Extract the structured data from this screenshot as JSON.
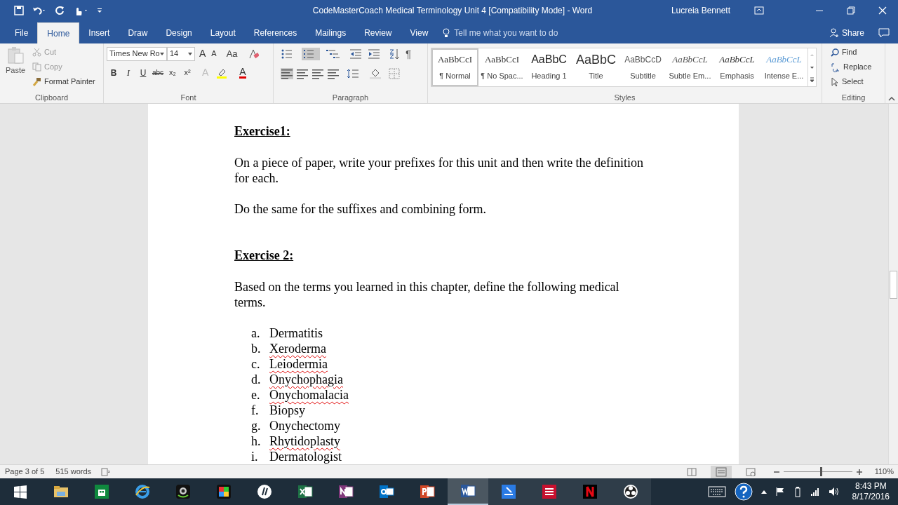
{
  "window": {
    "title": "CodeMasterCoach Medical Terminology Unit 4 [Compatibility Mode] - Word",
    "user": "Lucreia Bennett"
  },
  "tabs": [
    {
      "label": "File",
      "selected": false
    },
    {
      "label": "Home",
      "selected": true
    },
    {
      "label": "Insert",
      "selected": false
    },
    {
      "label": "Draw",
      "selected": false
    },
    {
      "label": "Design",
      "selected": false
    },
    {
      "label": "Layout",
      "selected": false
    },
    {
      "label": "References",
      "selected": false
    },
    {
      "label": "Mailings",
      "selected": false
    },
    {
      "label": "Review",
      "selected": false
    },
    {
      "label": "View",
      "selected": false
    }
  ],
  "tell_me": {
    "placeholder": "Tell me what you want to do"
  },
  "share": "Share",
  "clipboard": {
    "paste": "Paste",
    "cut": "Cut",
    "copy": "Copy",
    "format_painter": "Format Painter",
    "label": "Clipboard"
  },
  "font": {
    "name": "Times New Ro",
    "size": "14",
    "grow": "A",
    "shrink": "A",
    "case": "Aa",
    "buttons": [
      "B",
      "I",
      "U",
      "abc",
      "x₂",
      "x²"
    ],
    "text_effects": "A",
    "font_color": "A",
    "label": "Font"
  },
  "paragraph": {
    "label": "Paragraph",
    "pilcrow": "¶"
  },
  "styles": {
    "label": "Styles",
    "items": [
      {
        "preview": "AaBbCcI",
        "name": "¶ Normal",
        "kind": "body",
        "selected": true
      },
      {
        "preview": "AaBbCcI",
        "name": "¶ No Spac...",
        "kind": "body",
        "selected": false
      },
      {
        "preview": "AaBbC",
        "name": "Heading 1",
        "kind": "heading",
        "selected": false
      },
      {
        "preview": "AaBbC",
        "name": "Title",
        "kind": "title",
        "selected": false
      },
      {
        "preview": "AaBbCcD",
        "name": "Subtitle",
        "kind": "subtitle",
        "selected": false
      },
      {
        "preview": "AaBbCcL",
        "name": "Subtle Em...",
        "kind": "subtle",
        "selected": false
      },
      {
        "preview": "AaBbCcL",
        "name": "Emphasis",
        "kind": "emphasis",
        "selected": false
      },
      {
        "preview": "AaBbCcL",
        "name": "Intense E...",
        "kind": "intense",
        "selected": false
      }
    ]
  },
  "editing": {
    "find": "Find",
    "replace": "Replace",
    "select": "Select",
    "label": "Editing"
  },
  "document": {
    "blocks": [
      {
        "kind": "heading",
        "text": "Exercise1:"
      },
      {
        "kind": "paragraph",
        "text": "On a piece of paper, write your prefixes for this unit and then write the definition for each."
      },
      {
        "kind": "paragraph",
        "text": "Do the same for the suffixes and combining form."
      },
      {
        "kind": "heading",
        "text": "Exercise 2:"
      },
      {
        "kind": "paragraph",
        "text": "Based on the terms you learned in this chapter, define the following medical terms."
      },
      {
        "kind": "list",
        "items": [
          {
            "marker": "a.",
            "text": "Dermatitis",
            "misspelled": false
          },
          {
            "marker": "b.",
            "text": "Xeroderma",
            "misspelled": true
          },
          {
            "marker": "c.",
            "text": "Leiodermia",
            "misspelled": true
          },
          {
            "marker": "d.",
            "text": "Onychophagia",
            "misspelled": true
          },
          {
            "marker": "e.",
            "text": "Onychomalacia",
            "misspelled": true
          },
          {
            "marker": "f.",
            "text": "Biopsy",
            "misspelled": false
          },
          {
            "marker": "g.",
            "text": "Onychectomy",
            "misspelled": false
          },
          {
            "marker": "h.",
            "text": "Rhytidoplasty",
            "misspelled": true
          },
          {
            "marker": "i.",
            "text": "Dermatologist",
            "misspelled": false
          }
        ]
      }
    ]
  },
  "status_bar": {
    "page": "Page 3 of 5",
    "words": "515 words",
    "zoom": "110%",
    "level": 0.55
  },
  "taskbar": {
    "time": "8:43 PM",
    "date": "8/17/2016"
  }
}
